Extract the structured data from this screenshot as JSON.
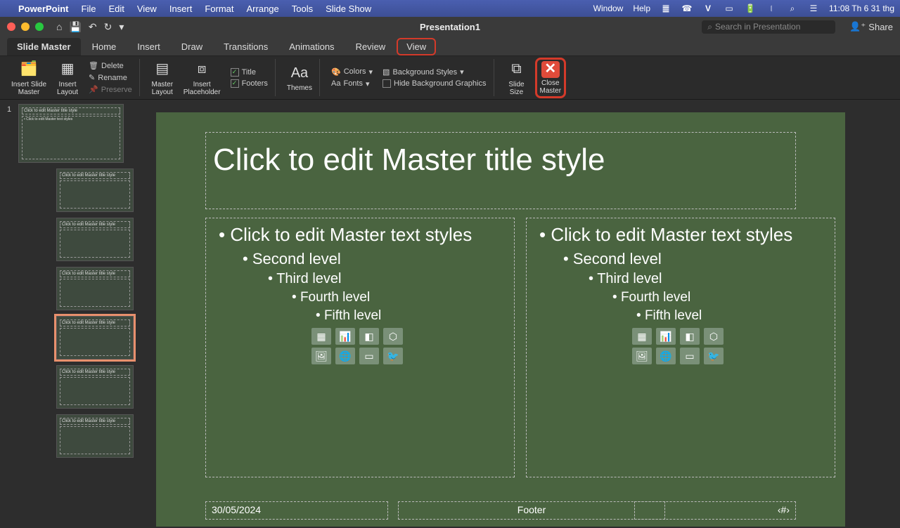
{
  "menubar": {
    "app": "PowerPoint",
    "items": [
      "File",
      "Edit",
      "View",
      "Insert",
      "Format",
      "Arrange",
      "Tools",
      "Slide Show"
    ],
    "right": [
      "Window",
      "Help"
    ],
    "clock": "11:08 Th 6 31 thg"
  },
  "titlebar": {
    "title": "Presentation1",
    "search_placeholder": "Search in Presentation",
    "share": "Share"
  },
  "tabs": [
    "Slide Master",
    "Home",
    "Insert",
    "Draw",
    "Transitions",
    "Animations",
    "Review",
    "View"
  ],
  "ribbon": {
    "insert_slide_master": "Insert Slide\nMaster",
    "insert_layout": "Insert\nLayout",
    "delete": "Delete",
    "rename": "Rename",
    "preserve": "Preserve",
    "master_layout": "Master\nLayout",
    "insert_placeholder": "Insert\nPlaceholder",
    "title_chk": "Title",
    "footers_chk": "Footers",
    "themes": "Themes",
    "colors": "Colors",
    "fonts": "Fonts",
    "bg_styles": "Background Styles",
    "hide_bg": "Hide Background Graphics",
    "slide_size": "Slide\nSize",
    "close_master": "Close\nMaster"
  },
  "thumbs": {
    "num": "1",
    "titles": [
      "Click to edit Master title style",
      "Click to edit Master title style",
      "Click to edit Master title style",
      "Click to edit Master title style",
      "Click to edit Master title style",
      "Click to edit Master title style",
      "Click to edit Master title style"
    ],
    "body": "• Click to edit Master text styles"
  },
  "slide": {
    "title": "Click to edit Master title style",
    "lv1": "Click to edit Master text styles",
    "lv2": "Second level",
    "lv3": "Third level",
    "lv4": "Fourth level",
    "lv5": "Fifth level",
    "date": "30/05/2024",
    "footer": "Footer",
    "num": "‹#›"
  }
}
